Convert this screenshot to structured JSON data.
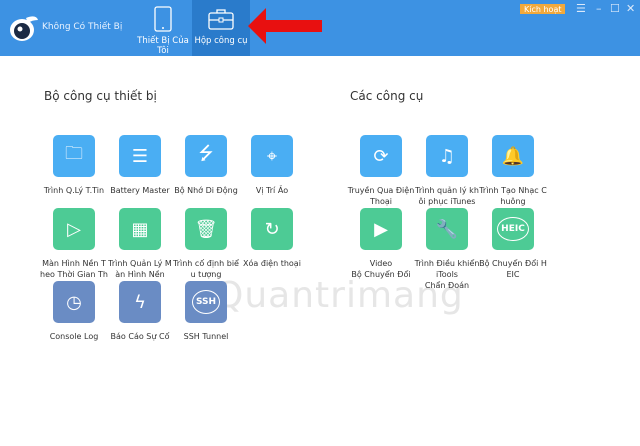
{
  "header": {
    "device": "Không Có Thiết Bị",
    "tabs": [
      {
        "label": "Thiết Bị Của Tôi"
      },
      {
        "label": "Hộp công cụ"
      }
    ],
    "activate": "Kích hoạt"
  },
  "colors": {
    "blue": "#4aaef3",
    "green": "#4dcb95",
    "slate": "#6a8cc4",
    "header": "#3d92e3"
  },
  "device_tools": {
    "title": "Bộ công cụ thiết bị",
    "items": [
      {
        "label": "Trình Q.Lý T.Tin",
        "icon": "folder-icon",
        "color": "blue"
      },
      {
        "label": "Battery Master",
        "icon": "clipboard-icon",
        "color": "blue"
      },
      {
        "label": "Bộ Nhớ Di Động",
        "icon": "usb-icon",
        "color": "blue"
      },
      {
        "label": "Vị Trí Ảo",
        "icon": "location-icon",
        "color": "blue"
      },
      {
        "label": "Màn Hình Nền Theo Thời Gian Thực",
        "icon": "play-icon",
        "color": "green"
      },
      {
        "label": "Trình Quản Lý Màn Hình Nền",
        "icon": "grid-icon",
        "color": "green"
      },
      {
        "label": "Trình cố định biểu tượng",
        "icon": "trash-icon",
        "color": "green"
      },
      {
        "label": "Xóa điện thoại",
        "icon": "phone-reset-icon",
        "color": "green"
      },
      {
        "label": "Console Log",
        "icon": "clock-icon",
        "color": "slate"
      },
      {
        "label": "Báo Cáo Sự Cố",
        "icon": "crash-icon",
        "color": "slate"
      },
      {
        "label": "SSH Tunnel",
        "icon": "ssh-icon",
        "color": "slate"
      }
    ]
  },
  "tools": {
    "title": "Các công cụ",
    "items": [
      {
        "label": "Truyền Qua Điện Thoại",
        "icon": "phone-transfer-icon",
        "color": "blue"
      },
      {
        "label": "Trình quản lý khôi phục iTunes",
        "icon": "music-icon",
        "color": "blue"
      },
      {
        "label": "Trình Tạo Nhạc Chuông",
        "icon": "bell-icon",
        "color": "blue"
      },
      {
        "label": "Video\nBộ Chuyển Đổi",
        "icon": "video-icon",
        "color": "green"
      },
      {
        "label": "Trình Điều khiển iTools\nChẩn Đoán",
        "icon": "wrench-icon",
        "color": "green"
      },
      {
        "label": "Bộ Chuyển Đổi HEIC",
        "icon": "heic-icon",
        "color": "green"
      }
    ]
  },
  "watermark": "Quantrimang"
}
